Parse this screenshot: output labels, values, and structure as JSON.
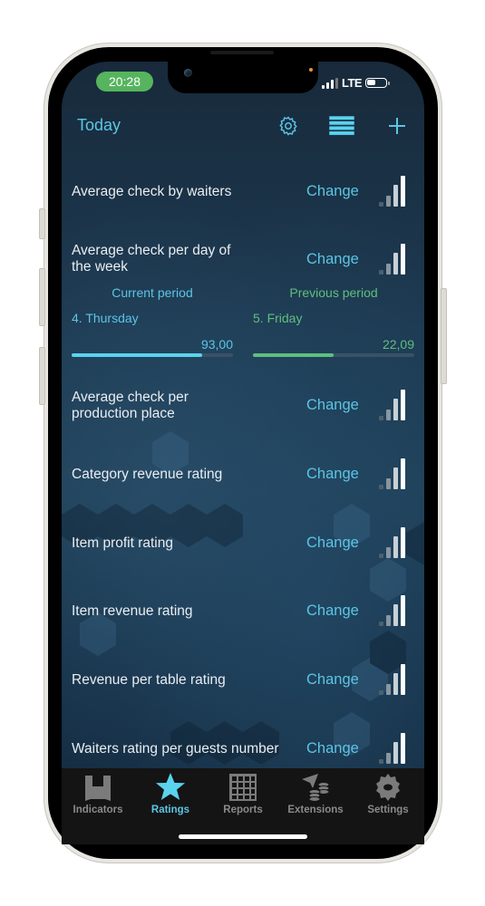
{
  "status_bar": {
    "time": "20:28",
    "network": "LTE",
    "signal_bars_filled": 3,
    "signal_bars_total": 4
  },
  "nav": {
    "title": "Today",
    "icons": [
      "gear-icon",
      "list-icon",
      "plus-icon"
    ]
  },
  "change_label": "Change",
  "rows": [
    {
      "label": "Average check by waiters",
      "change": "Change"
    },
    {
      "label": "Average check per day of the week",
      "change": "Change"
    },
    {
      "label": "Average check per production place",
      "change": "Change"
    },
    {
      "label": "Category revenue rating",
      "change": "Change"
    },
    {
      "label": "Item profit rating",
      "change": "Change"
    },
    {
      "label": "Item revenue rating",
      "change": "Change"
    },
    {
      "label": "Revenue per table rating",
      "change": "Change"
    },
    {
      "label": "Waiters rating per guests number",
      "change": "Change"
    }
  ],
  "comparison": {
    "current": {
      "header": "Current period",
      "item": "4. Thursday",
      "value": "93,00",
      "progress_pct": 81,
      "color": "#5ad3ef"
    },
    "previous": {
      "header": "Previous period",
      "item": "5. Friday",
      "value": "22,09",
      "progress_pct": 50,
      "color": "#5fbf7d"
    }
  },
  "tabbar": {
    "active": "Ratings",
    "accent": "#5bc5e4",
    "tabs": [
      {
        "label": "Indicators",
        "icon": "indicators-icon"
      },
      {
        "label": "Ratings",
        "icon": "star-icon"
      },
      {
        "label": "Reports",
        "icon": "grid-icon"
      },
      {
        "label": "Extensions",
        "icon": "extensions-icon"
      },
      {
        "label": "Settings",
        "icon": "settings-icon"
      }
    ]
  }
}
